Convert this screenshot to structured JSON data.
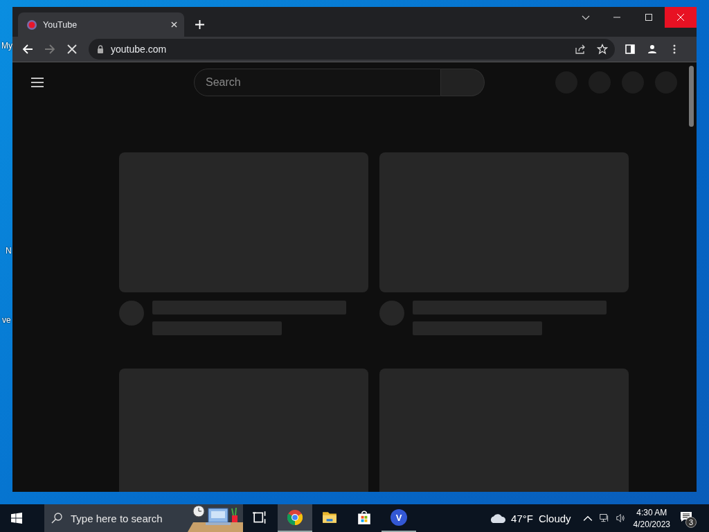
{
  "desktop": {
    "icon_labels": [
      "My",
      "N",
      "ve"
    ]
  },
  "browser": {
    "close_hovered": true,
    "tabs": [
      {
        "title": "YouTube",
        "selected": true
      }
    ],
    "address": {
      "url": "youtube.com",
      "loading": true
    },
    "page": {
      "search": {
        "placeholder": "Search"
      }
    }
  },
  "taskbar": {
    "search": {
      "placeholder": "Type here to search"
    },
    "apps": [
      {
        "kind": "taskview",
        "running": false,
        "selected": false
      },
      {
        "kind": "chrome",
        "running": true,
        "selected": true
      },
      {
        "kind": "explorer",
        "running": false,
        "selected": false
      },
      {
        "kind": "store",
        "running": false,
        "selected": false
      },
      {
        "kind": "vapp",
        "label": "V",
        "running": true,
        "selected": false
      }
    ],
    "weather": {
      "temperature": "47°F",
      "condition": "Cloudy"
    },
    "clock": {
      "time": "4:30 AM",
      "date": "4/20/2023"
    },
    "notifications": {
      "count": "3"
    }
  }
}
